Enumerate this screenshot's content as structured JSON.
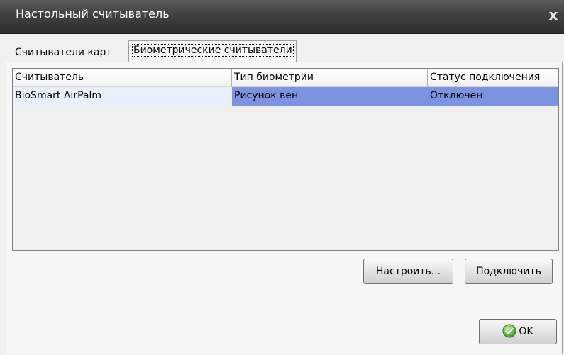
{
  "window": {
    "title": "Настольный считыватель",
    "close_label": "x"
  },
  "tabs": [
    {
      "label": "Считыватели карт",
      "active": false
    },
    {
      "label": "Биометрические считыватели",
      "active": true
    }
  ],
  "table": {
    "columns": [
      "Считыватель",
      "Тип биометрии",
      "Статус подключения"
    ],
    "rows": [
      [
        "BioSmart AirPalm",
        "Рисунок вен",
        "Отключен"
      ]
    ]
  },
  "buttons": {
    "configure": "Настроить...",
    "connect": "Подключить",
    "ok": "OK"
  },
  "icons": {
    "ok": "check-circle-icon",
    "close": "close-icon"
  },
  "colors": {
    "selection": "#7b93e0",
    "row_first_cell": "#e8f0fb",
    "titlebar": "#404040"
  }
}
